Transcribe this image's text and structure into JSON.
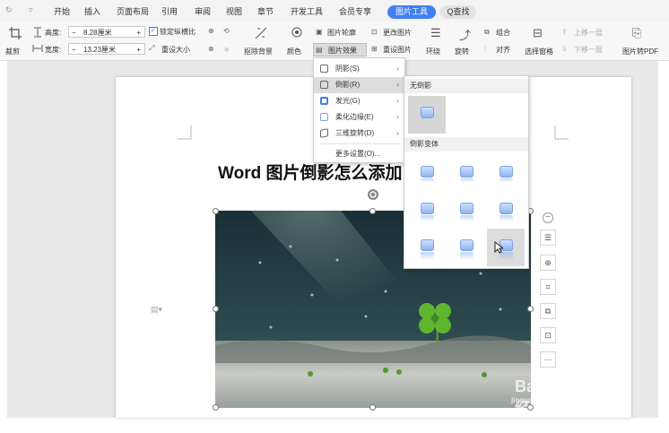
{
  "tabs": {
    "items": [
      "开始",
      "插入",
      "页面布局",
      "引用",
      "审阅",
      "视图",
      "章节",
      "开发工具",
      "会员专享"
    ],
    "active": "图片工具",
    "search": "Q查找"
  },
  "ribbon": {
    "height_label": "高度:",
    "height_value": "8.28厘米",
    "width_label": "宽度:",
    "width_value": "13.23厘米",
    "lock_ratio": "锁定纵横比",
    "reset_size": "重设大小",
    "crop": "裁剪",
    "remove_bg": "抠除背景",
    "color": "颜色",
    "outline": "图片轮廓",
    "effects": "图片效果",
    "change_pic": "更改图片",
    "reset_pic": "重设图片",
    "wrap": "环绕",
    "rotate": "旋转",
    "group": "组合",
    "align": "对齐",
    "selection_pane": "选择窗格",
    "bring_forward": "上移一层",
    "send_backward": "下移一层",
    "pic_to_pdf": "图片转PDF",
    "minus": "−",
    "plus": "+"
  },
  "menu": {
    "items": [
      {
        "label": "阴影(S)"
      },
      {
        "label": "倒影(R)"
      },
      {
        "label": "发光(G)"
      },
      {
        "label": "柔化边缘(E)"
      },
      {
        "label": "三维旋转(D)"
      }
    ],
    "more": "更多设置(O)..."
  },
  "submenu": {
    "no_reflection": "无倒影",
    "variants": "倒影变体"
  },
  "document": {
    "title": "Word 图片倒影怎么添加"
  },
  "watermark": {
    "brand": "Bai经验",
    "url": "jingyan.baidu.com"
  },
  "colors": {
    "accent": "#3f7ff0",
    "menu_highlight": "#dcdcdc"
  }
}
